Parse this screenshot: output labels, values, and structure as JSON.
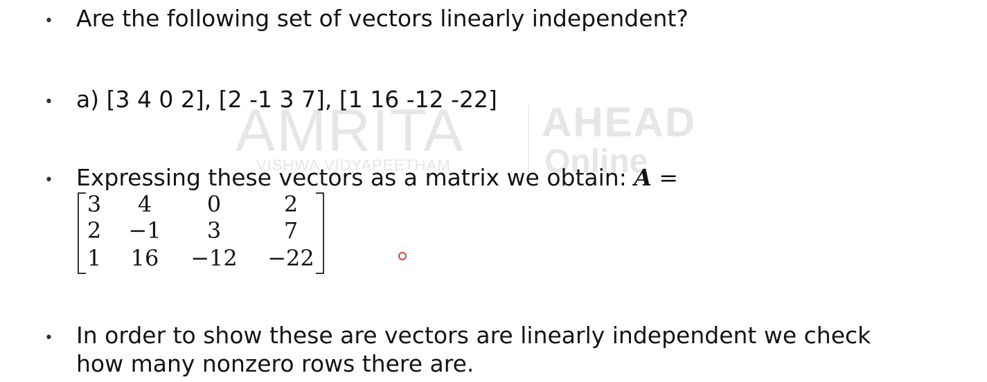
{
  "watermark": {
    "logo_text": "AMRITA",
    "sub_text": "VISHWA VIDYAPEETHAM",
    "brand": "AHEAD",
    "brand_sub": "Online"
  },
  "bullets": [
    {
      "text": "Are the following set of vectors linearly independent?"
    },
    {
      "text": "a) [3 4 0 2], [2 -1 3 7], [1 16 -12 -22]"
    },
    {
      "text": "Expressing these vectors as a matrix we obtain: ",
      "math_symbol": "A",
      "math_eq": " ="
    },
    {
      "line1": "In order to show these are vectors are linearly independent we check",
      "line2": "how many nonzero rows there are."
    }
  ],
  "matrix": {
    "rows": [
      [
        "3",
        "4",
        "0",
        "2"
      ],
      [
        "2",
        "−1",
        "3",
        "7"
      ],
      [
        "1",
        "16",
        "−12",
        "−22"
      ]
    ]
  },
  "colors": {
    "text": "#141414",
    "watermark": "#e6e6e6",
    "pointer": "#e23a3a"
  }
}
